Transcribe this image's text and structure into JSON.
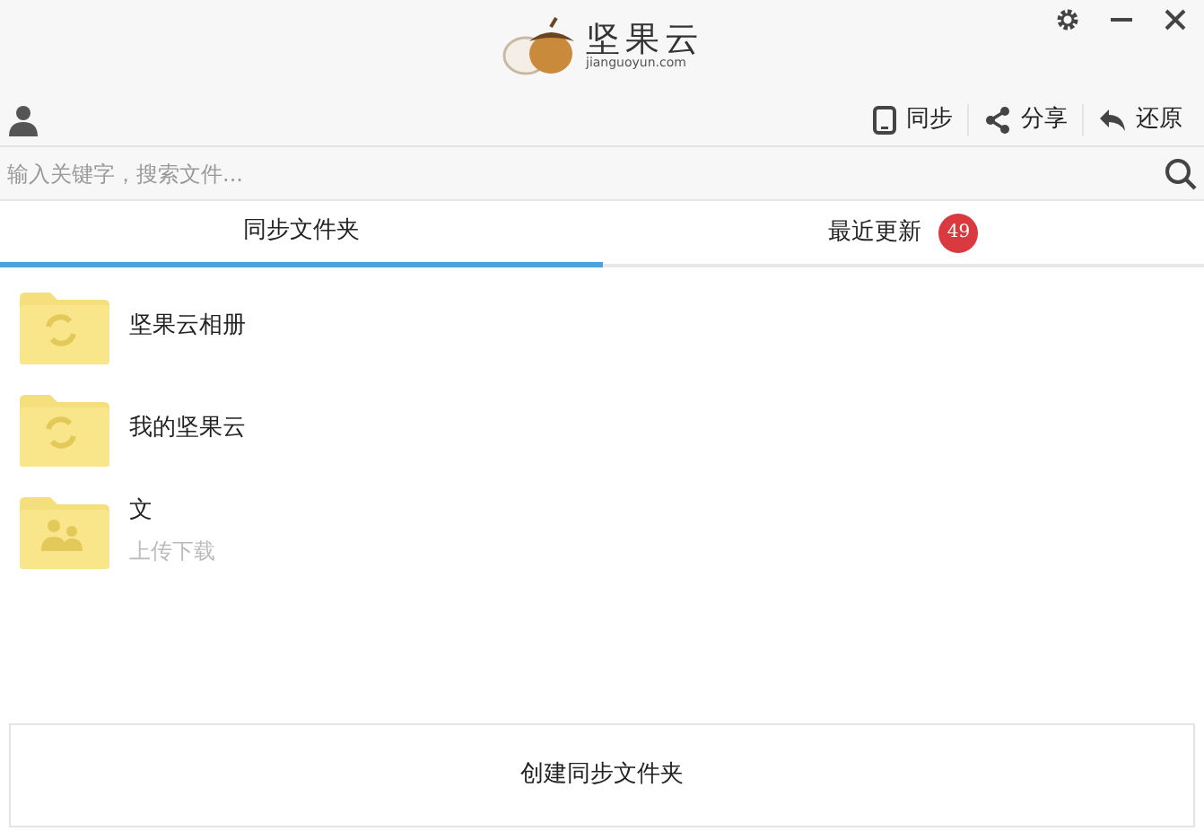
{
  "logo": {
    "name": "坚果云",
    "domain": "jianguoyun.com"
  },
  "actions": [
    {
      "kind": "sync",
      "label": "同步"
    },
    {
      "kind": "share",
      "label": "分享"
    },
    {
      "kind": "restore",
      "label": "还原"
    }
  ],
  "search": {
    "placeholder": "输入关键字，搜索文件..."
  },
  "tabs": [
    {
      "label": "同步文件夹",
      "selected": true
    },
    {
      "label": "最近更新",
      "selected": false,
      "badge": "49"
    }
  ],
  "folders": [
    {
      "kind": "sync",
      "name": "坚果云相册"
    },
    {
      "kind": "sync",
      "name": "我的坚果云"
    },
    {
      "kind": "shared",
      "name": "文",
      "subtitle": "上传下载"
    }
  ],
  "create_button": "创建同步文件夹"
}
